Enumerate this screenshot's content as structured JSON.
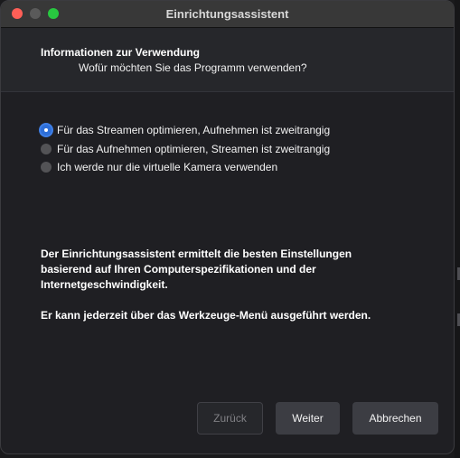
{
  "window": {
    "title": "Einrichtungsassistent"
  },
  "header": {
    "title": "Informationen zur Verwendung",
    "subtitle": "Wofür möchten Sie das Programm verwenden?"
  },
  "options": [
    {
      "label": "Für das Streamen optimieren, Aufnehmen ist zweitrangig",
      "selected": true
    },
    {
      "label": "Für das Aufnehmen optimieren, Streamen ist zweitrangig",
      "selected": false
    },
    {
      "label": "Ich werde nur die virtuelle Kamera verwenden",
      "selected": false
    }
  ],
  "info": {
    "paragraph1": "Der Einrichtungsassistent ermittelt die besten Einstellungen basierend auf Ihren Computerspezifikationen und der Internetgeschwindigkeit.",
    "paragraph2": "Er kann jederzeit über das Werkzeuge-Menü ausgeführt werden."
  },
  "buttons": {
    "back": "Zurück",
    "next": "Weiter",
    "cancel": "Abbrechen"
  },
  "colors": {
    "accent": "#2e6fd8",
    "close": "#ff5f57",
    "maximize": "#28c840"
  }
}
